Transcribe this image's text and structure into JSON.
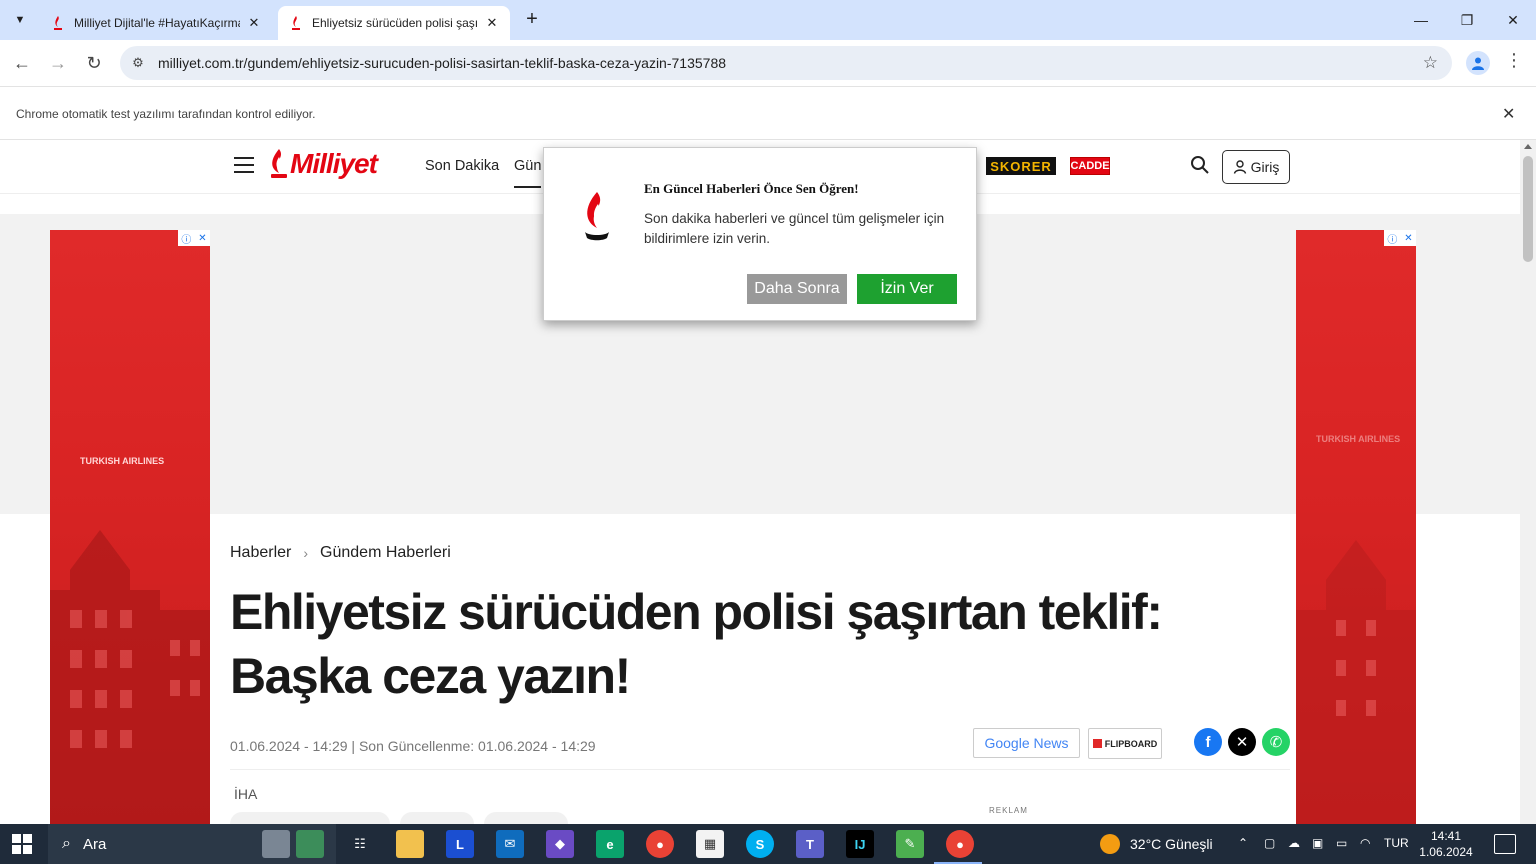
{
  "browser": {
    "tabs": [
      {
        "title": "Milliyet Dijital'le #HayatıKaçırma",
        "active": false
      },
      {
        "title": "Ehliyetsiz sürücüden polisi şaşırtan",
        "active": true
      }
    ],
    "url": "milliyet.com.tr/gundem/ehliyetsiz-surucuden-polisi-sasirtan-teklif-baska-ceza-yazin-7135788",
    "infobar_message": "Chrome otomatik test yazılımı tarafından kontrol ediliyor."
  },
  "site": {
    "logo": "Milliyet",
    "nav": [
      "Son Dakika",
      "Gün"
    ],
    "skorer": "SKORER",
    "cadde": "CADDE",
    "login": "Giriş"
  },
  "ads": {
    "left_brand": "TURKISH AIRLINES",
    "right_brand": "TURKISH AIRLINES",
    "reklam_label": "REKLAM"
  },
  "article": {
    "breadcrumb": [
      "Haberler",
      "Gündem Haberleri"
    ],
    "headline": "Ehliyetsiz sürücüden polisi şaşırtan teklif: Başka ceza yazın!",
    "dateline": "01.06.2024 - 14:29 | Son Güncellenme: 01.06.2024 - 14:29",
    "source": "İHA",
    "google_news": "Google News",
    "flipboard": "FLIPBOARD"
  },
  "notification": {
    "title": "En Güncel Haberleri Önce Sen Öğren!",
    "body": "Son dakika haberleri ve güncel tüm gelişmeler için bildirimlere izin verin.",
    "later_label": "Daha Sonra",
    "allow_label": "İzin Ver"
  },
  "taskbar": {
    "search_label": "Ara",
    "weather": "32°C  Güneşli",
    "lang": "TUR",
    "time": "14:41",
    "date": "1.06.2024"
  },
  "colors": {
    "brand_red": "#e30613",
    "allow_green": "#1ea130",
    "tabstrip": "#d3e3fd"
  }
}
